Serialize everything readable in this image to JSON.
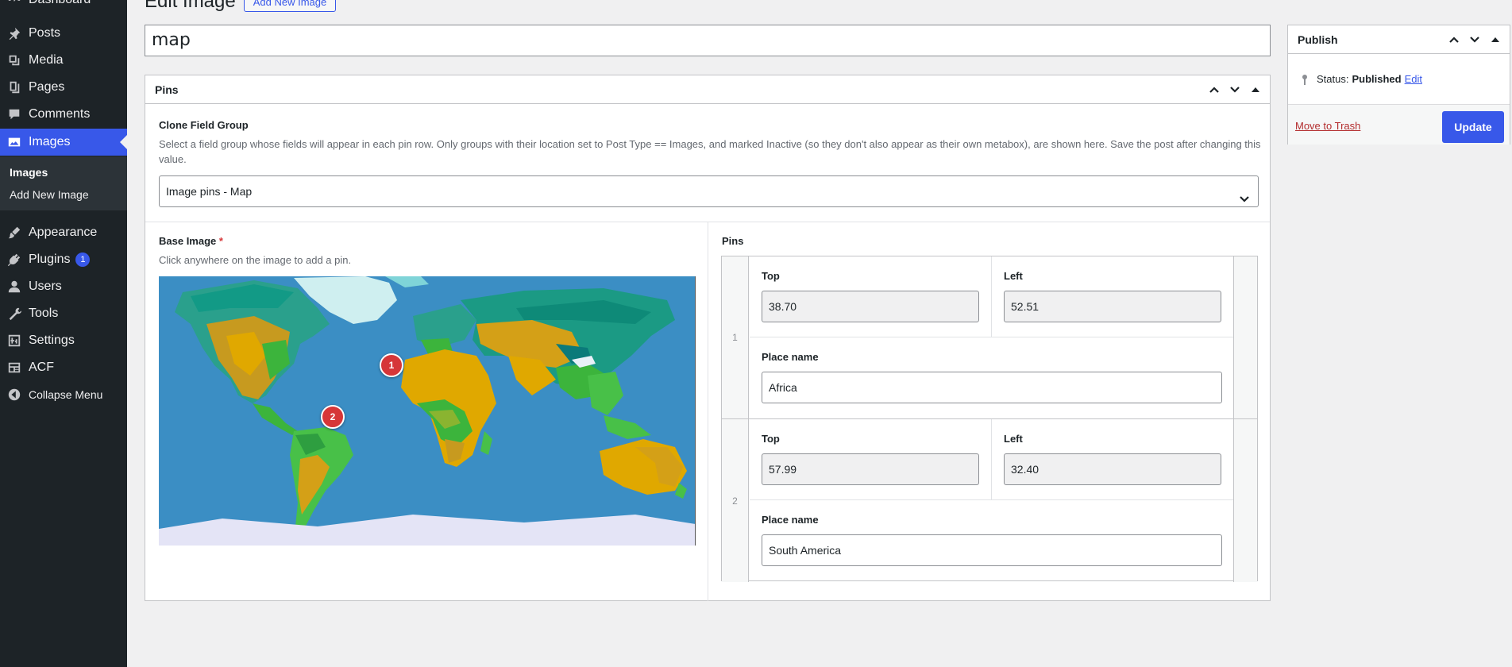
{
  "sidebar": {
    "items": [
      {
        "label": "Dashboard",
        "icon": "dashboard-icon"
      },
      {
        "label": "Posts",
        "icon": "pin-icon"
      },
      {
        "label": "Media",
        "icon": "media-icon"
      },
      {
        "label": "Pages",
        "icon": "pages-icon"
      },
      {
        "label": "Comments",
        "icon": "comments-icon"
      },
      {
        "label": "Images",
        "icon": "images-icon",
        "active": true
      },
      {
        "label": "Appearance",
        "icon": "brush-icon"
      },
      {
        "label": "Plugins",
        "icon": "plugin-icon",
        "badge": "1"
      },
      {
        "label": "Users",
        "icon": "user-icon"
      },
      {
        "label": "Tools",
        "icon": "wrench-icon"
      },
      {
        "label": "Settings",
        "icon": "settings-icon"
      },
      {
        "label": "ACF",
        "icon": "acf-icon"
      }
    ],
    "submenu": [
      "Images",
      "Add New Image"
    ],
    "collapse_label": "Collapse Menu"
  },
  "header": {
    "title": "Edit Image",
    "add_new_label": "Add New Image"
  },
  "post_title": "map",
  "pins_box": {
    "title": "Pins",
    "clone_field_label": "Clone Field Group",
    "clone_field_description": "Select a field group whose fields will appear in each pin row. Only groups with their location set to Post Type == Images, and marked Inactive (so they don't also appear as their own metabox), are shown here. Save the post after changing this value.",
    "clone_field_value": "Image pins - Map",
    "base_image_label": "Base Image",
    "base_image_required": "*",
    "base_image_help": "Click anywhere on the image to add a pin.",
    "map_pins": [
      {
        "number": "1",
        "top": 38.7,
        "left": 52.51
      },
      {
        "number": "2",
        "top": 57.99,
        "left": 32.4
      }
    ],
    "pins_label": "Pins",
    "rows": [
      {
        "index": "1",
        "top_label": "Top",
        "top_value": "38.70",
        "left_label": "Left",
        "left_value": "52.51",
        "place_label": "Place name",
        "place_value": "Africa"
      },
      {
        "index": "2",
        "top_label": "Top",
        "top_value": "57.99",
        "left_label": "Left",
        "left_value": "32.40",
        "place_label": "Place name",
        "place_value": "South America"
      }
    ]
  },
  "publish": {
    "title": "Publish",
    "status_label": "Status:",
    "status_value": "Published",
    "status_edit": "Edit",
    "trash_label": "Move to Trash",
    "update_label": "Update"
  },
  "colors": {
    "accent": "#3858e9",
    "sidebar_bg": "#1d2327",
    "pin_red": "#d63638",
    "ocean": "#3b8ec4"
  }
}
